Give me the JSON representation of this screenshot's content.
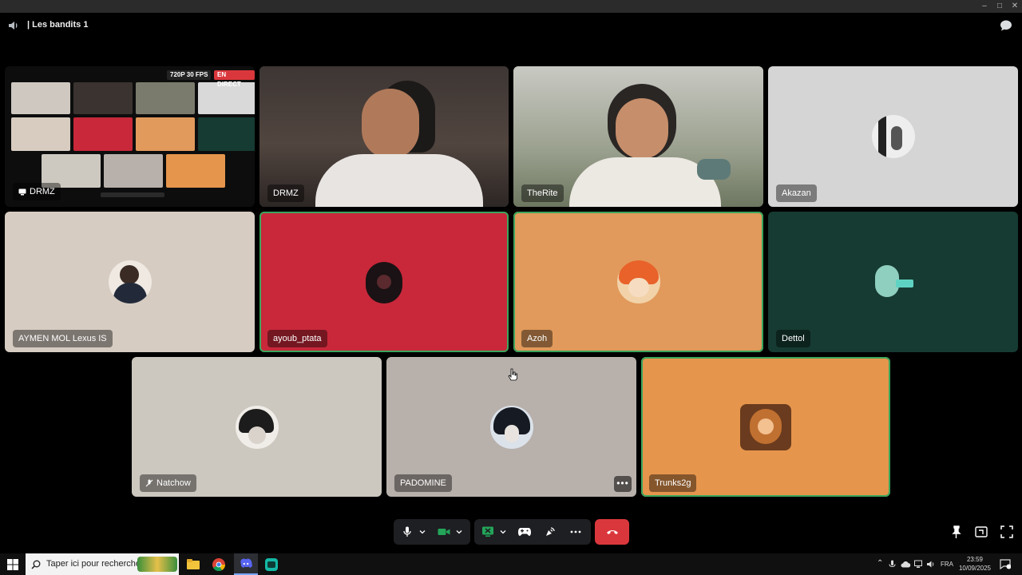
{
  "channel": {
    "title": "| Les bandits 1"
  },
  "stream": {
    "quality": "720P 30 FPS",
    "live": "EN DIRECT"
  },
  "tiles": [
    {
      "name": "DRMZ"
    },
    {
      "name": "DRMZ"
    },
    {
      "name": "TheRite"
    },
    {
      "name": "Akazan"
    },
    {
      "name": "AYMEN MOL Lexus IS"
    },
    {
      "name": "ayoub_ptata"
    },
    {
      "name": "Azoh"
    },
    {
      "name": "Dettol"
    },
    {
      "name": "Natchow"
    },
    {
      "name": "PADOMINE"
    },
    {
      "name": "Trunks2g"
    }
  ],
  "tile_more_label": "•••",
  "taskbar": {
    "search_placeholder": "Taper ici pour rechercher",
    "language": "FRA",
    "time": "23:59",
    "date": "10/09/2025"
  },
  "colors": {
    "tile_beige": "#d6ccc2",
    "tile_red": "#c8283a",
    "tile_orange": "#e19a5b",
    "tile_dark_teal": "#163b32",
    "tile_grey_light": "#ccc7bf",
    "tile_grey": "#b8b0ab",
    "tile_orange2": "#e5954c",
    "speaking_outline": "#3ba55c",
    "end_call": "#da373c"
  }
}
